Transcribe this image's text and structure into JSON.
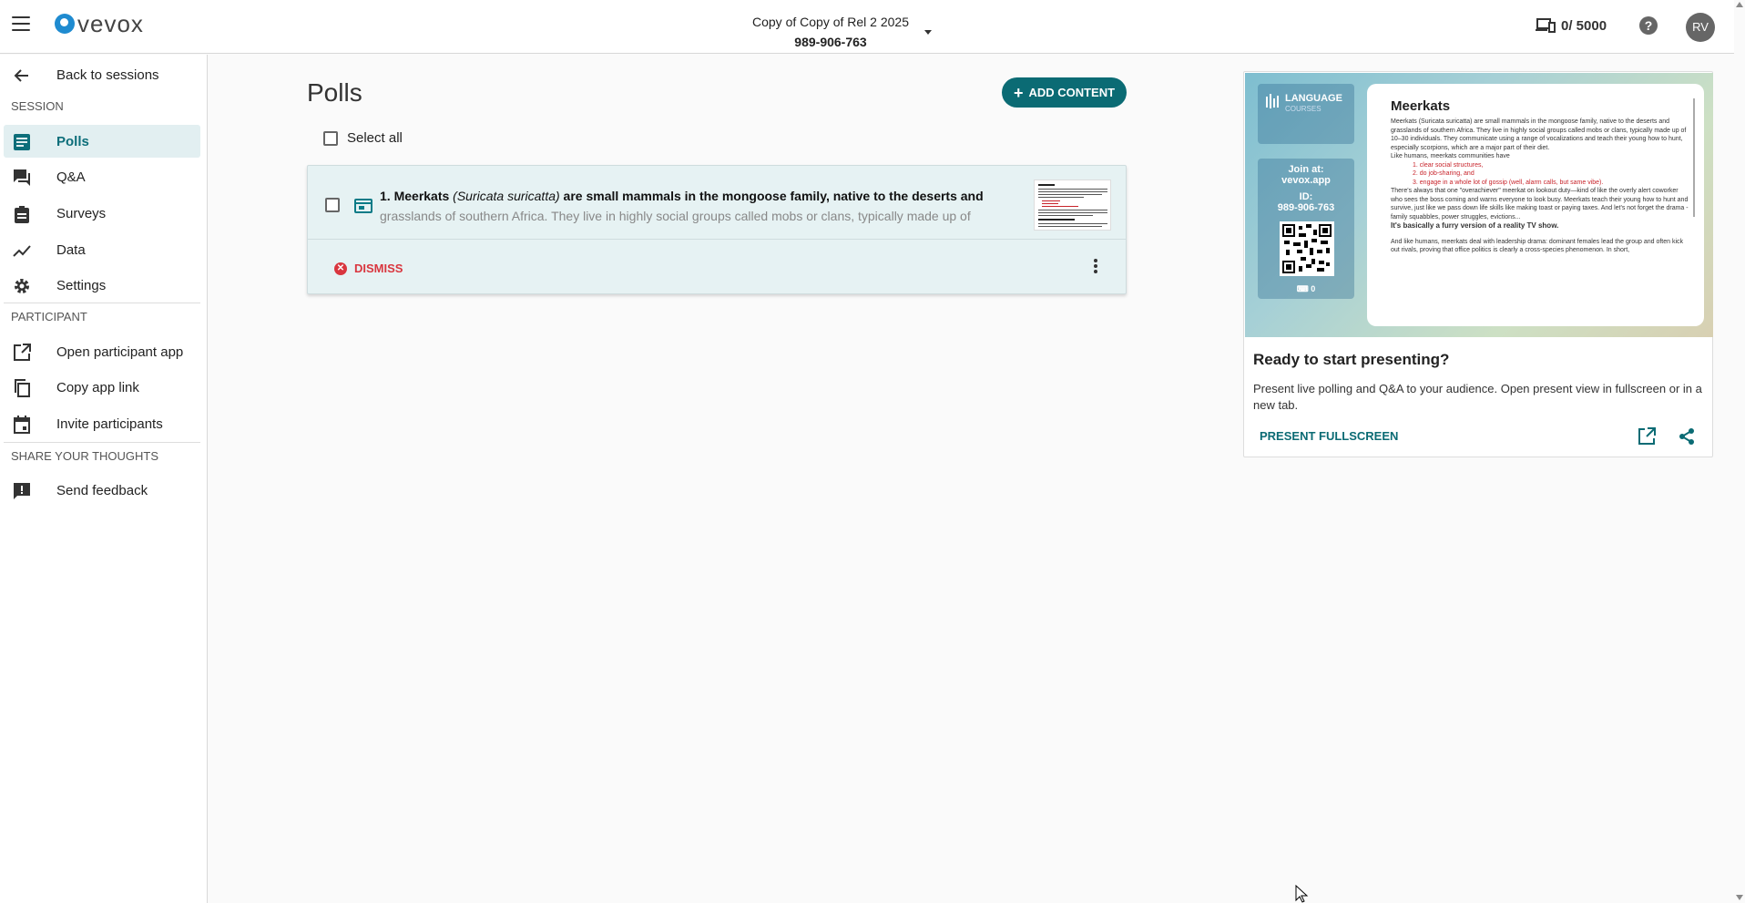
{
  "header": {
    "logo": "vevox",
    "session_title": "Copy of Copy of Rel 2 2025",
    "session_id": "989-906-763",
    "devices": "0/ 5000",
    "help": "?",
    "avatar": "RV"
  },
  "sidebar": {
    "back": "Back to sessions",
    "section_session": "SESSION",
    "items": [
      {
        "label": "Polls",
        "icon": "polls-icon",
        "active": true
      },
      {
        "label": "Q&A",
        "icon": "chat-icon"
      },
      {
        "label": "Surveys",
        "icon": "clipboard-icon"
      },
      {
        "label": "Data",
        "icon": "chart-line-icon"
      },
      {
        "label": "Settings",
        "icon": "gear-icon"
      }
    ],
    "section_participant": "PARTICIPANT",
    "participant_items": [
      {
        "label": "Open participant app",
        "icon": "external-link-icon"
      },
      {
        "label": "Copy app link",
        "icon": "copy-icon"
      },
      {
        "label": "Invite participants",
        "icon": "calendar-icon"
      }
    ],
    "section_feedback": "SHARE YOUR THOUGHTS",
    "feedback_item": {
      "label": "Send feedback",
      "icon": "feedback-icon"
    }
  },
  "main": {
    "title": "Polls",
    "add_button": "ADD CONTENT",
    "select_all": "Select all",
    "poll": {
      "number": "1.",
      "bold_start": "Meerkats",
      "italic": "(Suricata suricatta)",
      "bold_rest": "are small mammals in the mongoose family, native to the deserts and",
      "faded": "grasslands of southern Africa. They live in highly social groups called mobs or clans, typically made up of",
      "dismiss": "DISMISS"
    }
  },
  "preview": {
    "lang_logo": "LANGUAGE",
    "lang_logo_sub": "COURSES",
    "join_at_label": "Join at:",
    "join_at_url": "vevox.app",
    "id_label": "ID:",
    "id_value": "989-906-763",
    "participants": "0",
    "slide_title": "Meerkats",
    "slide_p1": "Meerkats (Suricata suricatta) are small mammals in the mongoose family, native to the deserts and grasslands of southern Africa. They live in highly social groups called mobs or clans, typically made up of 10–30 individuals. They communicate using a range of vocalizations and teach their young how to hunt, especially scorpions, which are a major part of their diet.",
    "slide_p2": "Like humans, meerkats communities have",
    "slide_list": [
      "1. clear social structures,",
      "2. do job-sharing, and",
      "3. engage in a whole lot of gossip (well, alarm calls, but same vibe)."
    ],
    "slide_p3": "There's always that one \"overachiever\" meerkat on lookout duty—kind of like the overly alert coworker who sees the boss coming and warns everyone to look busy. Meerkats teach their young how to hunt and survive, just like we pass down life skills like making toast or paying taxes. And let's not forget the drama - family squabbles, power struggles, evictions...",
    "slide_bold": "It's basically a furry version of a reality TV show.",
    "slide_p4": "And like humans, meerkats deal with leadership drama: dominant females lead the group and often kick out rivals, proving that office politics is clearly a cross-species phenomenon. In short,",
    "ready_title": "Ready to start presenting?",
    "ready_desc": "Present live polling and Q&A to your audience. Open present view in fullscreen or in a new tab.",
    "present_button": "PRESENT FULLSCREEN"
  },
  "colors": {
    "accent": "#0b6b74",
    "active_bg": "#e2eff1",
    "danger": "#d9363e"
  }
}
